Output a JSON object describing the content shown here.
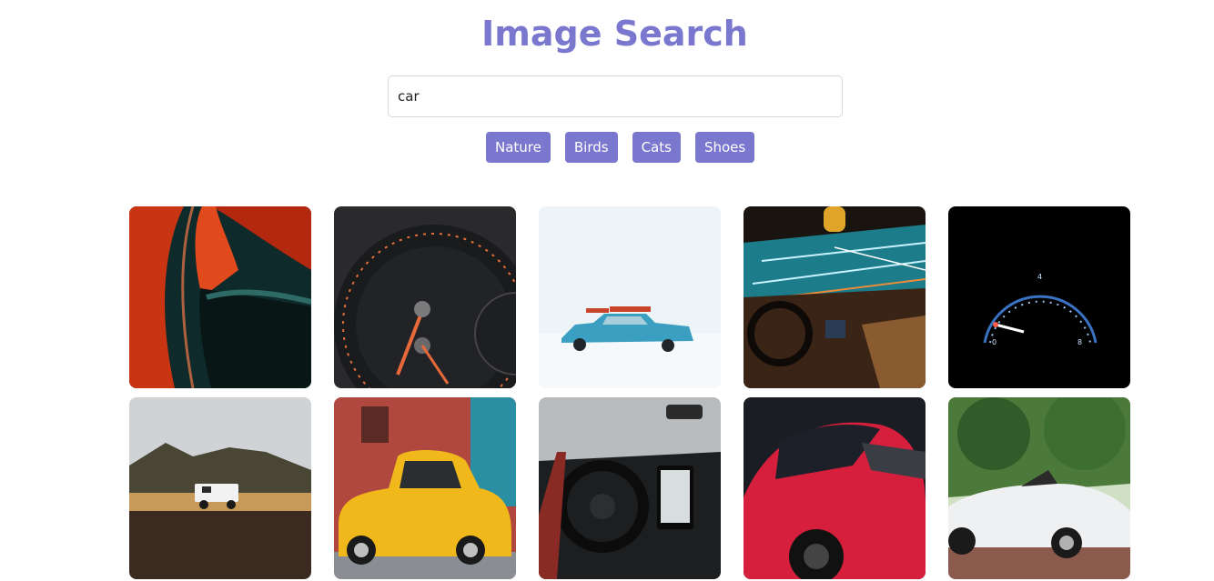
{
  "header": {
    "title": "Image Search"
  },
  "search": {
    "value": "car"
  },
  "categories": [
    "Nature",
    "Birds",
    "Cats",
    "Shoes"
  ],
  "results": [
    {
      "subject": "red car door close-up"
    },
    {
      "subject": "speedometer gauge close-up"
    },
    {
      "subject": "blue vintage car in snow"
    },
    {
      "subject": "car interior with light trails"
    },
    {
      "subject": "illuminated speedometer at night"
    },
    {
      "subject": "white off-road vehicle on plain"
    },
    {
      "subject": "yellow vintage taxi on street"
    },
    {
      "subject": "pickup truck dashboard interior"
    },
    {
      "subject": "red sports car rear"
    },
    {
      "subject": "white convertible in park"
    }
  ]
}
